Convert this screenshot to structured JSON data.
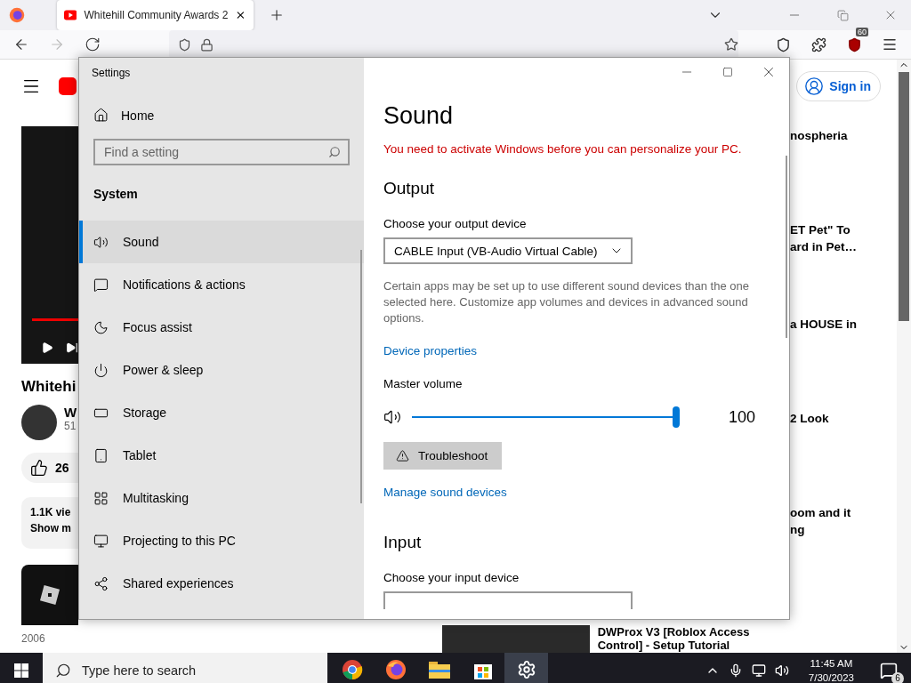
{
  "browser": {
    "tab": {
      "title": "Whitehill Community Awards 2",
      "selected": true
    },
    "forward_disabled": true,
    "extension_badge": "60"
  },
  "youtube": {
    "sign_in": "Sign in",
    "video_title": "Whitehi",
    "channel_initial": "W",
    "channel_subs": "51",
    "likes": "26",
    "progress": {
      "level": 1
    },
    "description": [
      "1.1K vie",
      "Show m"
    ],
    "recommendations": [
      {
        "lines": [
          "nospheria"
        ]
      },
      {
        "lines": [
          "ET Pet\" To",
          "ard in Pet…"
        ]
      },
      {
        "lines": [
          "a HOUSE in"
        ]
      },
      {
        "lines": [
          "2 Look"
        ]
      },
      {
        "lines": [
          "oom and it",
          "ng"
        ]
      }
    ],
    "bottom": {
      "date": "2006",
      "title_lines": [
        "DWProx V3 [Roblox Access",
        "Control] - Setup Tutorial"
      ]
    }
  },
  "settings": {
    "title": "Settings",
    "home": "Home",
    "search_placeholder": "Find a setting",
    "section": "System",
    "nav": [
      {
        "label": "Sound",
        "kind": "sound",
        "selected": true
      },
      {
        "label": "Notifications & actions",
        "kind": "notifications",
        "selected": false
      },
      {
        "label": "Focus assist",
        "kind": "focus",
        "selected": false
      },
      {
        "label": "Power & sleep",
        "kind": "power",
        "selected": false
      },
      {
        "label": "Storage",
        "kind": "storage",
        "selected": false
      },
      {
        "label": "Tablet",
        "kind": "tablet",
        "selected": false
      },
      {
        "label": "Multitasking",
        "kind": "multitasking",
        "selected": false
      },
      {
        "label": "Projecting to this PC",
        "kind": "projecting",
        "selected": false
      },
      {
        "label": "Shared experiences",
        "kind": "shared",
        "selected": false
      }
    ],
    "page": {
      "heading": "Sound",
      "warning": "You need to activate Windows before you can personalize your PC.",
      "output_heading": "Output",
      "output_label": "Choose your output device",
      "output_device": "CABLE Input (VB-Audio Virtual Cable)",
      "description": "Certain apps may be set up to use different sound devices than the one selected here. Customize app volumes and devices in advanced sound options.",
      "device_properties": "Device properties",
      "volume_label": "Master volume",
      "volume": {
        "level": 1,
        "reading": "100"
      },
      "troubleshoot": "Troubleshoot",
      "manage": "Manage sound devices",
      "input_heading": "Input",
      "input_label": "Choose your input device"
    }
  },
  "taskbar": {
    "search_placeholder": "Type here to search",
    "apps": [
      {
        "kind": "chrome",
        "active": false
      },
      {
        "kind": "firefox",
        "active": false
      },
      {
        "kind": "explorer",
        "active": false
      },
      {
        "kind": "store",
        "active": false
      },
      {
        "kind": "settings",
        "active": true
      }
    ],
    "time": "11:45 AM",
    "date": "7/30/2023",
    "notifications": "6"
  }
}
